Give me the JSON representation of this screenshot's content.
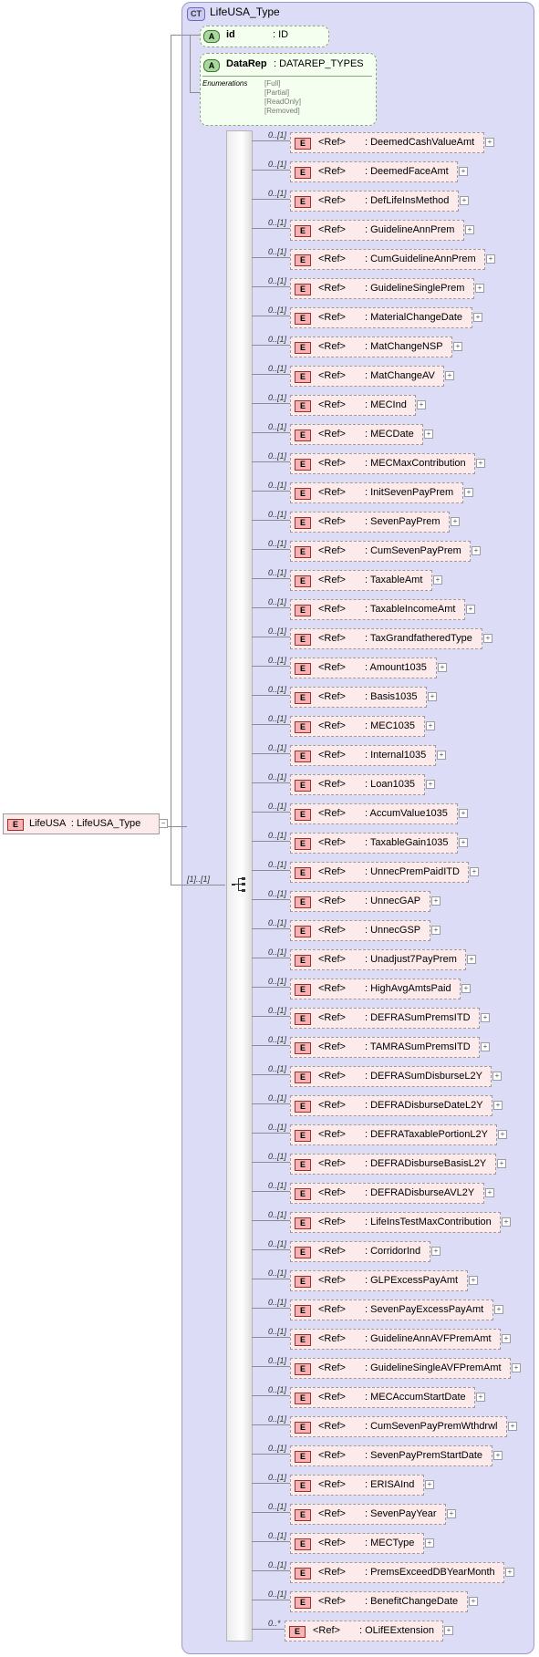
{
  "complex_type": {
    "badge": "CT",
    "name": "LifeUSA_Type"
  },
  "root_element": {
    "badge": "E",
    "label": "LifeUSA  : LifeUSA_Type"
  },
  "attributes": [
    {
      "badge": "A",
      "name": "id",
      "type": ": ID"
    },
    {
      "badge": "A",
      "name": "DataRep",
      "type": ": DATAREP_TYPES",
      "enumerations_label": "Enumerations",
      "enumerations": [
        "[Full]",
        "[Partial]",
        "[ReadOnly]",
        "[Removed]"
      ]
    }
  ],
  "sequence_cardinality": "[1]..[1]",
  "elements": [
    {
      "card": "0..[1]",
      "ref": "<Ref>",
      "name": ": DeemedCashValueAmt"
    },
    {
      "card": "0..[1]",
      "ref": "<Ref>",
      "name": ": DeemedFaceAmt"
    },
    {
      "card": "0..[1]",
      "ref": "<Ref>",
      "name": ": DefLifeInsMethod"
    },
    {
      "card": "0..[1]",
      "ref": "<Ref>",
      "name": ": GuidelineAnnPrem"
    },
    {
      "card": "0..[1]",
      "ref": "<Ref>",
      "name": ": CumGuidelineAnnPrem"
    },
    {
      "card": "0..[1]",
      "ref": "<Ref>",
      "name": ": GuidelineSinglePrem"
    },
    {
      "card": "0..[1]",
      "ref": "<Ref>",
      "name": ": MaterialChangeDate"
    },
    {
      "card": "0..[1]",
      "ref": "<Ref>",
      "name": ": MatChangeNSP"
    },
    {
      "card": "0..[1]",
      "ref": "<Ref>",
      "name": ": MatChangeAV"
    },
    {
      "card": "0..[1]",
      "ref": "<Ref>",
      "name": ": MECInd"
    },
    {
      "card": "0..[1]",
      "ref": "<Ref>",
      "name": ": MECDate"
    },
    {
      "card": "0..[1]",
      "ref": "<Ref>",
      "name": ": MECMaxContribution"
    },
    {
      "card": "0..[1]",
      "ref": "<Ref>",
      "name": ": InitSevenPayPrem"
    },
    {
      "card": "0..[1]",
      "ref": "<Ref>",
      "name": ": SevenPayPrem"
    },
    {
      "card": "0..[1]",
      "ref": "<Ref>",
      "name": ": CumSevenPayPrem"
    },
    {
      "card": "0..[1]",
      "ref": "<Ref>",
      "name": ": TaxableAmt"
    },
    {
      "card": "0..[1]",
      "ref": "<Ref>",
      "name": ": TaxableIncomeAmt"
    },
    {
      "card": "0..[1]",
      "ref": "<Ref>",
      "name": ": TaxGrandfatheredType"
    },
    {
      "card": "0..[1]",
      "ref": "<Ref>",
      "name": ": Amount1035"
    },
    {
      "card": "0..[1]",
      "ref": "<Ref>",
      "name": ": Basis1035"
    },
    {
      "card": "0..[1]",
      "ref": "<Ref>",
      "name": ": MEC1035"
    },
    {
      "card": "0..[1]",
      "ref": "<Ref>",
      "name": ": Internal1035"
    },
    {
      "card": "0..[1]",
      "ref": "<Ref>",
      "name": ": Loan1035"
    },
    {
      "card": "0..[1]",
      "ref": "<Ref>",
      "name": ": AccumValue1035"
    },
    {
      "card": "0..[1]",
      "ref": "<Ref>",
      "name": ": TaxableGain1035"
    },
    {
      "card": "0..[1]",
      "ref": "<Ref>",
      "name": ": UnnecPremPaidITD"
    },
    {
      "card": "0..[1]",
      "ref": "<Ref>",
      "name": ": UnnecGAP"
    },
    {
      "card": "0..[1]",
      "ref": "<Ref>",
      "name": ": UnnecGSP"
    },
    {
      "card": "0..[1]",
      "ref": "<Ref>",
      "name": ": Unadjust7PayPrem"
    },
    {
      "card": "0..[1]",
      "ref": "<Ref>",
      "name": ": HighAvgAmtsPaid"
    },
    {
      "card": "0..[1]",
      "ref": "<Ref>",
      "name": ": DEFRASumPremsITD"
    },
    {
      "card": "0..[1]",
      "ref": "<Ref>",
      "name": ": TAMRASumPremsITD"
    },
    {
      "card": "0..[1]",
      "ref": "<Ref>",
      "name": ": DEFRASumDisburseL2Y"
    },
    {
      "card": "0..[1]",
      "ref": "<Ref>",
      "name": ": DEFRADisburseDateL2Y"
    },
    {
      "card": "0..[1]",
      "ref": "<Ref>",
      "name": ": DEFRATaxablePortionL2Y"
    },
    {
      "card": "0..[1]",
      "ref": "<Ref>",
      "name": ": DEFRADisburseBasisL2Y"
    },
    {
      "card": "0..[1]",
      "ref": "<Ref>",
      "name": ": DEFRADisburseAVL2Y"
    },
    {
      "card": "0..[1]",
      "ref": "<Ref>",
      "name": ": LifeInsTestMaxContribution"
    },
    {
      "card": "0..[1]",
      "ref": "<Ref>",
      "name": ": CorridorInd"
    },
    {
      "card": "0..[1]",
      "ref": "<Ref>",
      "name": ": GLPExcessPayAmt"
    },
    {
      "card": "0..[1]",
      "ref": "<Ref>",
      "name": ": SevenPayExcessPayAmt"
    },
    {
      "card": "0..[1]",
      "ref": "<Ref>",
      "name": ": GuidelineAnnAVFPremAmt"
    },
    {
      "card": "0..[1]",
      "ref": "<Ref>",
      "name": ": GuidelineSingleAVFPremAmt"
    },
    {
      "card": "0..[1]",
      "ref": "<Ref>",
      "name": ": MECAccumStartDate"
    },
    {
      "card": "0..[1]",
      "ref": "<Ref>",
      "name": ": CumSevenPayPremWthdrwl"
    },
    {
      "card": "0..[1]",
      "ref": "<Ref>",
      "name": ": SevenPayPremStartDate"
    },
    {
      "card": "0..[1]",
      "ref": "<Ref>",
      "name": ": ERISAInd"
    },
    {
      "card": "0..[1]",
      "ref": "<Ref>",
      "name": ": SevenPayYear"
    },
    {
      "card": "0..[1]",
      "ref": "<Ref>",
      "name": ": MECType"
    },
    {
      "card": "0..[1]",
      "ref": "<Ref>",
      "name": ": PremsExceedDBYearMonth"
    },
    {
      "card": "0..[1]",
      "ref": "<Ref>",
      "name": ": BenefitChangeDate"
    },
    {
      "card": "0..*",
      "ref": "<Ref>",
      "name": ": OLifEExtension"
    }
  ]
}
